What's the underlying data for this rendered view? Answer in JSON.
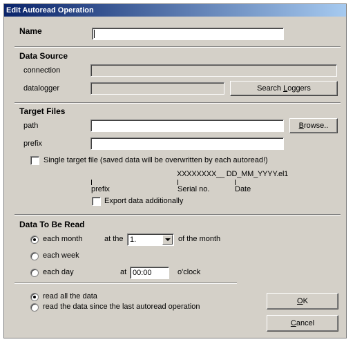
{
  "window": {
    "title": "Edit Autoread Operation"
  },
  "name_section": {
    "label": "Name",
    "value": ""
  },
  "data_source": {
    "heading": "Data Source",
    "connection_label": "connection",
    "connection_value": "",
    "datalogger_label": "datalogger",
    "datalogger_value": "",
    "search_button": "Search Loggers",
    "search_button_pre": "Search ",
    "search_button_accel": "L",
    "search_button_post": "oggers"
  },
  "target_files": {
    "heading": "Target Files",
    "path_label": "path",
    "path_value": "",
    "browse_button": "Browse..",
    "browse_button_accel": "B",
    "browse_button_post": "rowse..",
    "prefix_label": "prefix",
    "prefix_value": "",
    "single_target_label": "Single target file (saved data will be overwritten by each autoread!)",
    "single_target_checked": false,
    "pattern": "XXXXXXXX__  DD_MM_YYYY.el1",
    "legend_prefix": "prefix",
    "legend_serial": "Serial no.",
    "legend_date": "Date",
    "export_label": "Export data additionally",
    "export_checked": false
  },
  "data_to_be_read": {
    "heading": "Data To Be Read",
    "each_month_label": "each month",
    "at_the_label": "at the",
    "day_value": "1.",
    "of_the_month_label": "of the month",
    "each_week_label": "each week",
    "each_day_label": "each day",
    "at_label": "at",
    "time_value": "00:00",
    "oclock_label": "o'clock",
    "frequency_selected": "each month"
  },
  "read_mode": {
    "read_all_label": "read all the data",
    "read_since_label": "read the data since the last autoread operation",
    "selected": "read all the data"
  },
  "buttons": {
    "ok": "OK",
    "ok_accel": "O",
    "ok_post": "K",
    "cancel": "Cancel",
    "cancel_accel": "C",
    "cancel_post": "ancel"
  }
}
